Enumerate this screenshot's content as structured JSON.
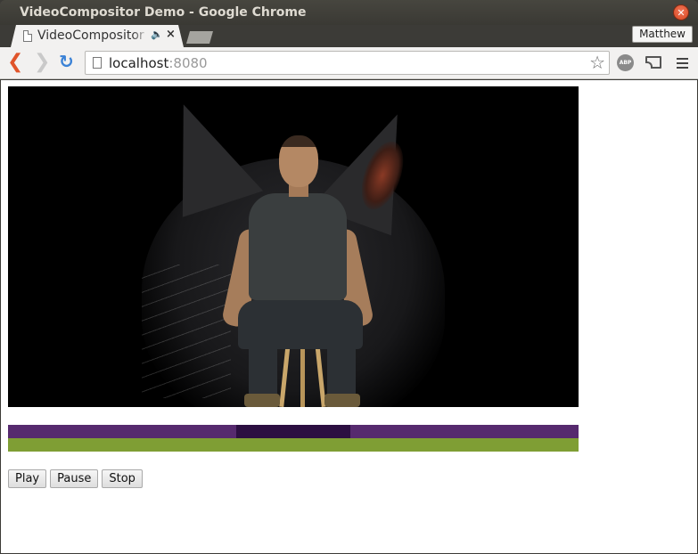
{
  "window": {
    "title": "VideoCompositor Demo - Google Chrome",
    "close_icon": "close-icon"
  },
  "tabs": [
    {
      "label": "VideoCompositor Demo",
      "audio_icon": "speaker-icon",
      "active": true
    }
  ],
  "profile": {
    "name": "Matthew"
  },
  "omnibox": {
    "host": "localhost",
    "port": ":8080"
  },
  "toolbar_icons": [
    "back-icon",
    "forward-icon",
    "reload-icon",
    "star-icon",
    "adblock-icon",
    "cast-icon",
    "menu-icon"
  ],
  "extensions": {
    "adblock_label": "ABP"
  },
  "timeline": {
    "tracks": [
      {
        "segments": [
          {
            "start": 0.0,
            "end": 0.4,
            "color": "#562a6e"
          },
          {
            "start": 0.4,
            "end": 0.6,
            "color": "#2c0f41"
          },
          {
            "start": 0.6,
            "end": 1.0,
            "color": "#562a6e"
          }
        ]
      },
      {
        "segments": [
          {
            "start": 0.0,
            "end": 1.0,
            "color": "#7f9e34"
          }
        ]
      }
    ]
  },
  "controls": {
    "play_label": "Play",
    "pause_label": "Pause",
    "stop_label": "Stop"
  },
  "colors": {
    "accent_back": "#e0542a",
    "reload": "#3b82d6",
    "close_button": "#e05a30"
  }
}
